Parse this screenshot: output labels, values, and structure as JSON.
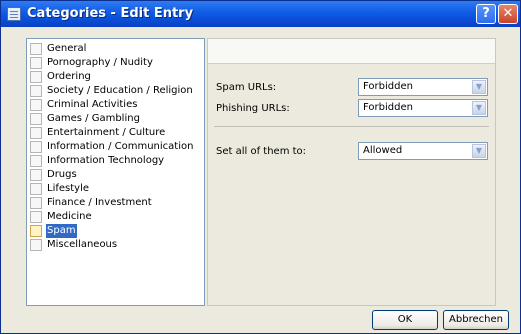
{
  "window": {
    "title": "Categories - Edit Entry",
    "help_label": "?",
    "close_label": "✕",
    "icon": "window-app-icon"
  },
  "categories": [
    {
      "label": "General",
      "selected": false
    },
    {
      "label": "Pornography / Nudity",
      "selected": false
    },
    {
      "label": "Ordering",
      "selected": false
    },
    {
      "label": "Society / Education / Religion",
      "selected": false
    },
    {
      "label": "Criminal Activities",
      "selected": false
    },
    {
      "label": "Games / Gambling",
      "selected": false
    },
    {
      "label": "Entertainment / Culture",
      "selected": false
    },
    {
      "label": "Information / Communication",
      "selected": false
    },
    {
      "label": "Information Technology",
      "selected": false
    },
    {
      "label": "Drugs",
      "selected": false
    },
    {
      "label": "Lifestyle",
      "selected": false
    },
    {
      "label": "Finance / Investment",
      "selected": false
    },
    {
      "label": "Medicine",
      "selected": false
    },
    {
      "label": "Spam",
      "selected": true
    },
    {
      "label": "Miscellaneous",
      "selected": false
    }
  ],
  "settings": {
    "spam_urls": {
      "label": "Spam URLs:",
      "value": "Forbidden"
    },
    "phishing_urls": {
      "label": "Phishing URLs:",
      "value": "Forbidden"
    },
    "set_all": {
      "label": "Set all of them to:",
      "value": "Allowed"
    }
  },
  "buttons": {
    "ok": "OK",
    "cancel": "Abbrechen"
  },
  "colors": {
    "titlebar": "#0a4fd7",
    "selection": "#316ac5",
    "dialog_bg": "#eceade"
  }
}
